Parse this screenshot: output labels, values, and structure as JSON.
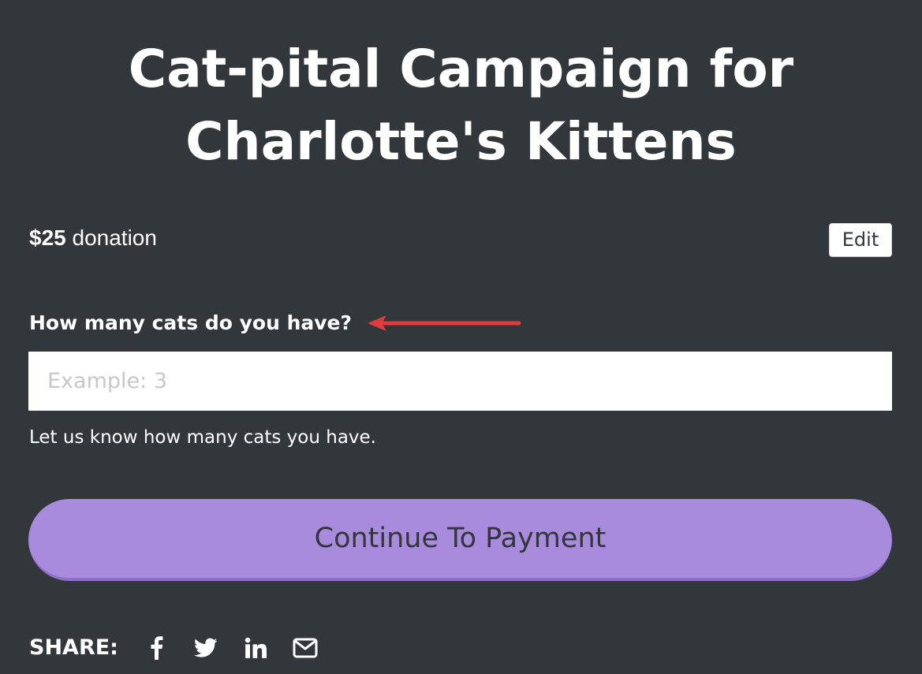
{
  "header": {
    "title_line1": "Cat-pital Campaign for",
    "title_line2": "Charlotte's Kittens"
  },
  "donation": {
    "amount": "$25",
    "label": " donation",
    "edit_label": "Edit"
  },
  "question": {
    "label": "How many cats do you have?",
    "placeholder": "Example: 3",
    "value": "",
    "help_text": "Let us know how many cats you have."
  },
  "annotation": {
    "arrow_color": "#e03a3a"
  },
  "actions": {
    "continue_label": "Continue To Payment"
  },
  "share": {
    "label": "SHARE:",
    "icons": [
      "facebook-icon",
      "twitter-icon",
      "linkedin-icon",
      "email-icon"
    ]
  },
  "colors": {
    "background": "#32373c",
    "button": "#a88bdc",
    "text": "#ffffff"
  }
}
